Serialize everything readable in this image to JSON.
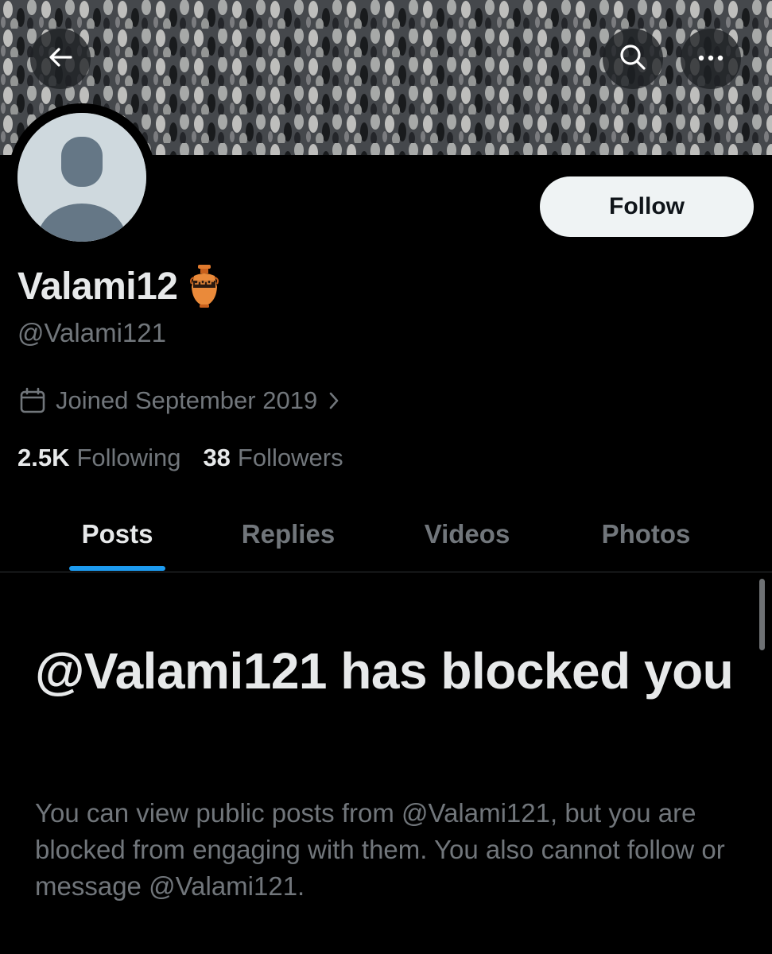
{
  "header": {
    "back_icon": "arrow-left-icon",
    "search_icon": "search-icon",
    "more_icon": "more-horizontal-icon"
  },
  "profile": {
    "display_name": "Valami12",
    "name_emoji": "amphora-icon",
    "handle": "@Valami121",
    "joined": "Joined September 2019",
    "following_count": "2.5K",
    "following_label": "Following",
    "followers_count": "38",
    "followers_label": "Followers",
    "follow_button_label": "Follow"
  },
  "tabs": [
    {
      "label": "Posts",
      "active": true
    },
    {
      "label": "Replies",
      "active": false
    },
    {
      "label": "Videos",
      "active": false
    },
    {
      "label": "Photos",
      "active": false
    }
  ],
  "blocked": {
    "title": "@Valami121 has blocked you",
    "description": "You can view public posts from @Valami121, but you are blocked from engaging with them. You also cannot follow or message @Valami121."
  },
  "colors": {
    "background": "#000000",
    "primary_text": "#e7e9ea",
    "secondary_text": "#71767b",
    "accent": "#1d9bf0",
    "follow_button_bg": "#eff3f4"
  }
}
